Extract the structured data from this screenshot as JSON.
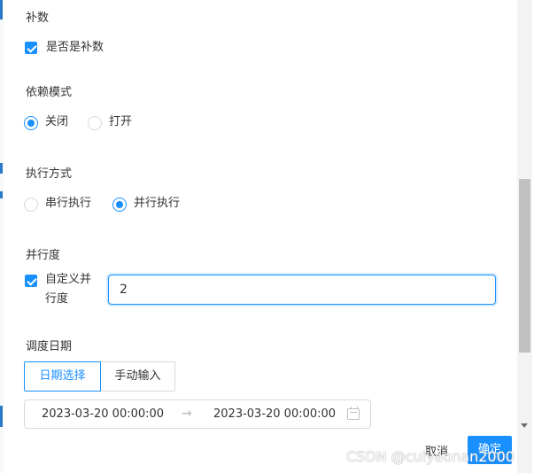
{
  "form": {
    "makeup": {
      "label": "补数",
      "checkbox_label": "是否是补数",
      "checked": true
    },
    "dependency_mode": {
      "label": "依赖模式",
      "options": [
        {
          "label": "关闭",
          "selected": true
        },
        {
          "label": "打开",
          "selected": false
        }
      ]
    },
    "execution_mode": {
      "label": "执行方式",
      "options": [
        {
          "label": "串行执行",
          "selected": false
        },
        {
          "label": "并行执行",
          "selected": true
        }
      ]
    },
    "parallelism": {
      "label": "并行度",
      "checkbox_label_line1": "自定义并",
      "checkbox_label_line2": "行度",
      "checked": true,
      "value": "2"
    },
    "schedule_date": {
      "label": "调度日期",
      "tabs": [
        {
          "label": "日期选择",
          "active": true
        },
        {
          "label": "手动输入",
          "active": false
        }
      ],
      "start": "2023-03-20 00:00:00",
      "end": "2023-03-20 00:00:00",
      "separator": "→"
    }
  },
  "footer": {
    "cancel_label": "取消",
    "confirm_label": "确定"
  },
  "watermark": "CSDN @cuiyaonan2000",
  "colors": {
    "primary": "#1890ff",
    "text": "#333333",
    "border": "#d9d9d9"
  }
}
